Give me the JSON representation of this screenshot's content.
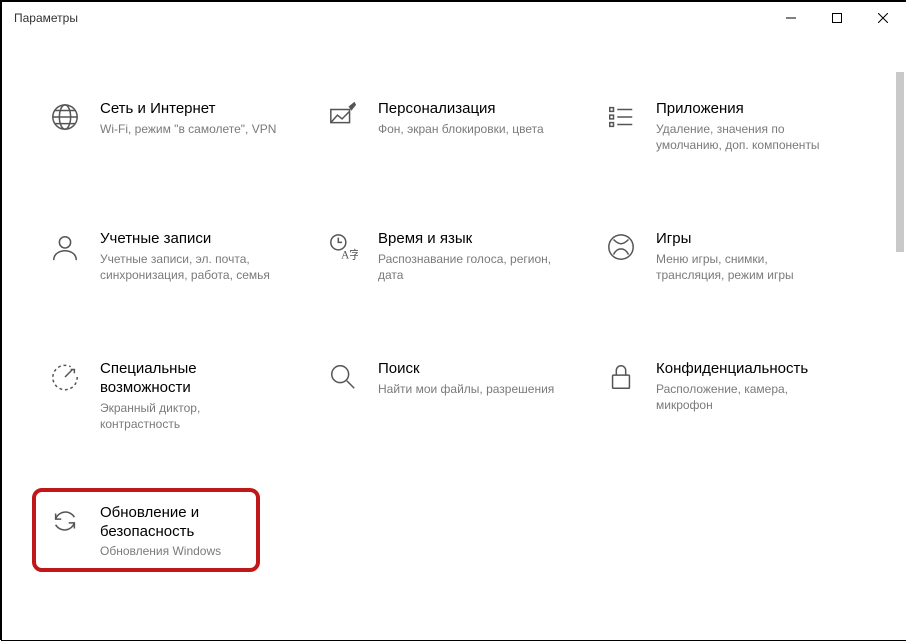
{
  "window": {
    "title": "Параметры"
  },
  "tiles": [
    {
      "id": "network",
      "title": "Сеть и Интернет",
      "desc": "Wi-Fi, режим \"в самолете\", VPN"
    },
    {
      "id": "personal",
      "title": "Персонализация",
      "desc": "Фон, экран блокировки, цвета"
    },
    {
      "id": "apps",
      "title": "Приложения",
      "desc": "Удаление, значения по умолчанию, доп. компоненты"
    },
    {
      "id": "accounts",
      "title": "Учетные записи",
      "desc": "Учетные записи, эл. почта, синхронизация, работа, семья"
    },
    {
      "id": "time",
      "title": "Время и язык",
      "desc": "Распознавание голоса, регион, дата"
    },
    {
      "id": "gaming",
      "title": "Игры",
      "desc": "Меню игры, снимки, трансляция, режим игры"
    },
    {
      "id": "access",
      "title": "Специальные возможности",
      "desc": "Экранный диктор, контрастность"
    },
    {
      "id": "search",
      "title": "Поиск",
      "desc": "Найти мои файлы, разрешения"
    },
    {
      "id": "privacy",
      "title": "Конфиденциальность",
      "desc": "Расположение, камера, микрофон"
    },
    {
      "id": "update",
      "title": "Обновление и безопасность",
      "desc": "Обновления Windows"
    }
  ]
}
